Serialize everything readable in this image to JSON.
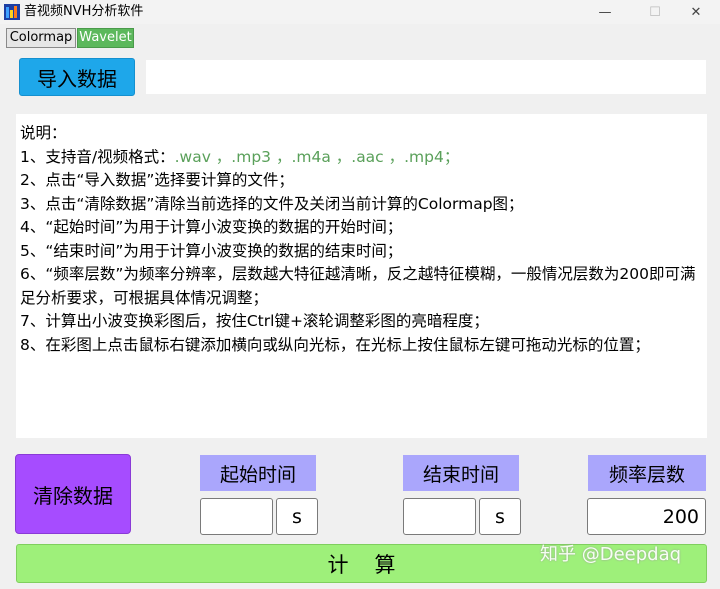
{
  "window": {
    "title": "音视频NVH分析软件",
    "minimize_glyph": "—",
    "maximize_glyph": "☐",
    "close_glyph": "✕"
  },
  "tabs": [
    {
      "label": "Colormap",
      "active": false
    },
    {
      "label": "Wavelet",
      "active": true,
      "color": "#5cb85c"
    }
  ],
  "import": {
    "button_label": "导入数据",
    "path_value": "",
    "button_color": "#1ea7ea"
  },
  "instructions": {
    "heading": "说明：",
    "line1_prefix": "1、支持音/视频格式：",
    "line1_formats": ".wav ，.mp3 ，.m4a ，.aac ，.mp4；",
    "lines": [
      "2、点击“导入数据”选择要计算的文件；",
      "3、点击“清除数据”清除当前选择的文件及关闭当前计算的Colormap图；",
      "4、“起始时间”为用于计算小波变换的数据的开始时间；",
      "5、“结束时间”为用于计算小波变换的数据的结束时间；",
      "6、“频率层数”为频率分辨率，层数越大特征越清晰，反之越特征模糊，一般情况层数为200即可满足分析要求，可根据具体情况调整；",
      "7、计算出小波变换彩图后，按住Ctrl键+滚轮调整彩图的亮暗程度；",
      "8、在彩图上点击鼠标右键添加横向或纵向光标，在光标上按住鼠标左键可拖动光标的位置；"
    ]
  },
  "controls": {
    "clear_label": "清除数据",
    "clear_color": "#a64cff",
    "start_time_label": "起始时间",
    "start_time_value": "",
    "start_time_unit": "s",
    "end_time_label": "结束时间",
    "end_time_value": "",
    "end_time_unit": "s",
    "freq_levels_label": "频率层数",
    "freq_levels_value": "200",
    "label_bg_color": "#aaa6fc"
  },
  "calculate": {
    "label": "计算",
    "color": "#9ef07a"
  },
  "watermark": "知乎 @Deepdaq"
}
